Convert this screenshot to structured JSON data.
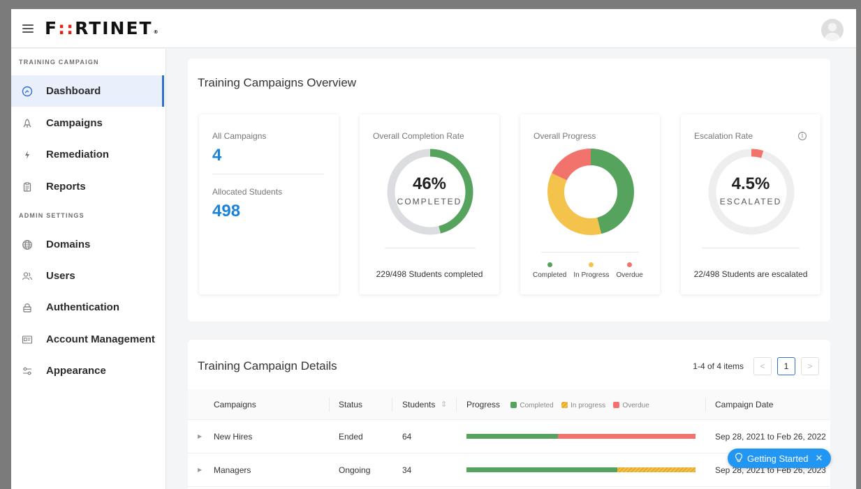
{
  "header": {
    "logo_prefix": "F",
    "logo_mid": "::",
    "logo_rest": "RTINET",
    "logo_reg": "®"
  },
  "sidebar": {
    "section1": "TRAINING CAMPAIGN",
    "section2": "ADMIN SETTINGS",
    "items": [
      {
        "label": "Dashboard",
        "icon": "dashboard-icon"
      },
      {
        "label": "Campaigns",
        "icon": "campaigns-icon"
      },
      {
        "label": "Remediation",
        "icon": "lightning-icon"
      },
      {
        "label": "Reports",
        "icon": "clipboard-icon"
      },
      {
        "label": "Domains",
        "icon": "globe-icon"
      },
      {
        "label": "Users",
        "icon": "users-icon"
      },
      {
        "label": "Authentication",
        "icon": "lock-icon"
      },
      {
        "label": "Account Management",
        "icon": "id-card-icon"
      },
      {
        "label": "Appearance",
        "icon": "sliders-icon"
      }
    ],
    "active": "Dashboard"
  },
  "overview": {
    "title": "Training Campaigns Overview",
    "all_campaigns_label": "All Campaigns",
    "all_campaigns_value": "4",
    "allocated_label": "Allocated Students",
    "allocated_value": "498",
    "completion": {
      "label": "Overall Completion Rate",
      "pct_text": "46%",
      "sub": "COMPLETED",
      "foot": "229/498 Students completed",
      "fraction": 0.46
    },
    "progress": {
      "label": "Overall Progress",
      "completed_fraction": 0.46,
      "in_progress_fraction": 0.36,
      "overdue_fraction": 0.18,
      "legend": [
        "Completed",
        "In Progress",
        "Overdue"
      ]
    },
    "escalation": {
      "label": "Escalation Rate",
      "pct_text": "4.5%",
      "sub": "ESCALATED",
      "foot": "22/498 Students are escalated",
      "fraction": 0.045
    }
  },
  "details": {
    "title": "Training Campaign Details",
    "pager_info": "1-4 of 4 items",
    "current_page": "1",
    "prev": "<",
    "next": ">",
    "columns": {
      "campaigns": "Campaigns",
      "status": "Status",
      "students": "Students",
      "progress": "Progress",
      "date": "Campaign Date"
    },
    "sort_icon": "⇕",
    "legend": {
      "completed": "Completed",
      "in_progress": "In progress",
      "overdue": "Overdue"
    },
    "rows": [
      {
        "name": "New Hires",
        "status": "Ended",
        "students": "64",
        "date": "Sep 28, 2021 to Feb 26, 2022",
        "completed": 0.4,
        "in_progress": 0.0,
        "overdue": 0.6
      },
      {
        "name": "Managers",
        "status": "Ongoing",
        "students": "34",
        "date": "Sep 28, 2021 to Feb 26, 2023",
        "completed": 0.66,
        "in_progress": 0.34,
        "overdue": 0.0
      }
    ]
  },
  "getting_started": {
    "label": "Getting Started",
    "close": "✕"
  },
  "colors": {
    "completed": "#55a35d",
    "in_progress": "#f3c34b",
    "overdue": "#f2736c",
    "track": "#dcdde0",
    "accent": "#2f6fd1",
    "big_number": "#1b84d9"
  }
}
